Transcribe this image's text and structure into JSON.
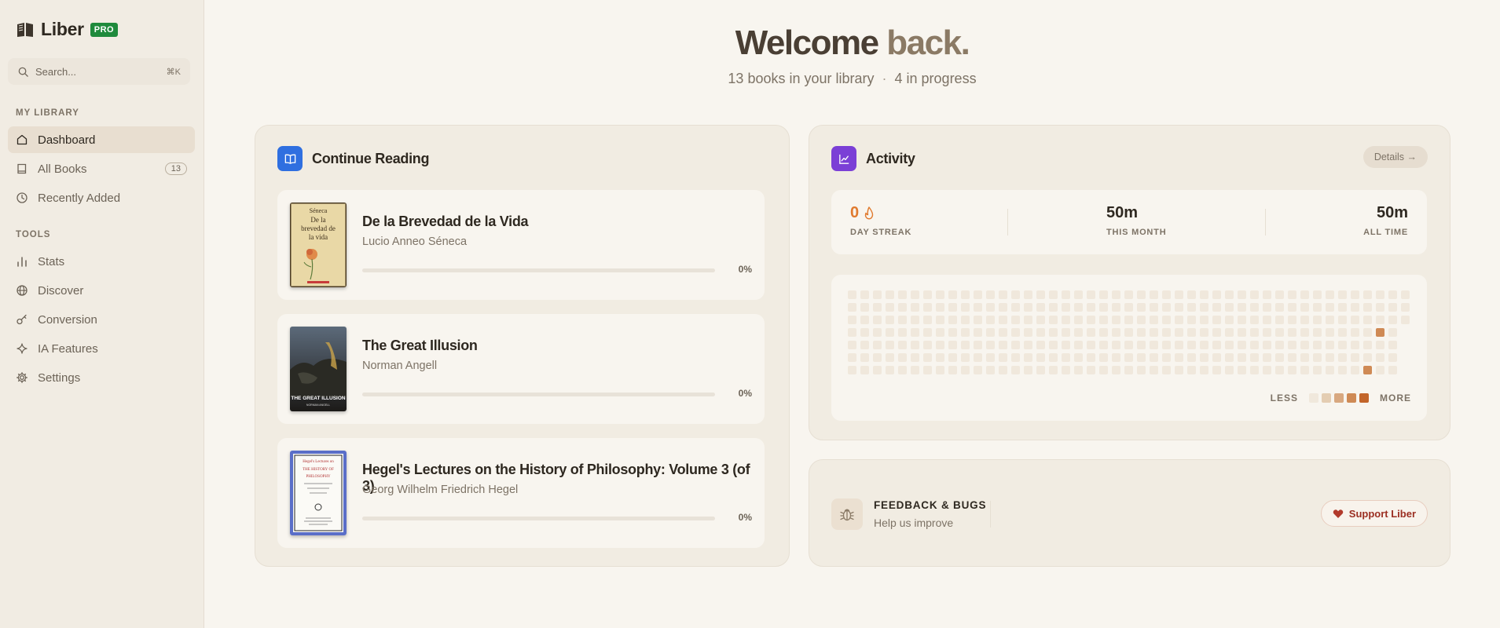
{
  "sidebar": {
    "brand": "Liber",
    "badge": "PRO",
    "search": {
      "placeholder": "Search...",
      "shortcut": "⌘K"
    },
    "sections": [
      {
        "label": "MY LIBRARY"
      },
      {
        "label": "TOOLS"
      }
    ],
    "items": [
      {
        "label": "Dashboard",
        "icon": "home-icon",
        "active": true
      },
      {
        "label": "All Books",
        "icon": "book-icon",
        "count": "13"
      },
      {
        "label": "Recently Added",
        "icon": "clock-icon"
      },
      {
        "label": "Stats",
        "icon": "bar-chart-icon"
      },
      {
        "label": "Discover",
        "icon": "globe-icon"
      },
      {
        "label": "Conversion",
        "icon": "key-icon"
      },
      {
        "label": "IA Features",
        "icon": "sparkle-icon"
      },
      {
        "label": "Settings",
        "icon": "gear-icon"
      }
    ]
  },
  "header": {
    "welcome_1": "Welcome",
    "welcome_2": "back.",
    "books_count": "13 books in your library",
    "separator": "·",
    "in_progress": "4 in progress"
  },
  "continue_reading": {
    "title": "Continue Reading",
    "books": [
      {
        "title": "De la Brevedad de la Vida",
        "author": "Lucio Anneo Séneca",
        "progress": 0,
        "progress_label": "0%",
        "cover_lines": [
          "Séneca",
          "De la",
          "brevedad de",
          "la vida"
        ]
      },
      {
        "title": "The Great Illusion",
        "author": "Norman Angell",
        "progress": 0,
        "progress_label": "0%",
        "cover_lines": [
          "THE GREAT ILLUSION",
          "NORMAN ANGELL"
        ]
      },
      {
        "title": "Hegel's Lectures on the History of Philosophy: Volume 3 (of 3)",
        "author": "Georg Wilhelm Friedrich Hegel",
        "progress": 0,
        "progress_label": "0%",
        "cover_lines": [
          "Hegel's Lectures on",
          "THE HISTORY OF",
          "PHILOSOPHY"
        ]
      }
    ]
  },
  "activity": {
    "title": "Activity",
    "details_label": "Details →",
    "stats": [
      {
        "value": "0",
        "label": "DAY STREAK",
        "accent": "#e07a2e"
      },
      {
        "value": "50m",
        "label": "THIS MONTH"
      },
      {
        "value": "50m",
        "label": "ALL TIME"
      }
    ],
    "heatmap": {
      "weeks": 45,
      "days": 7,
      "active_cells": [
        {
          "week": 42,
          "day": 3,
          "level": 3
        },
        {
          "week": 41,
          "day": 6,
          "level": 3
        }
      ],
      "legend_less": "LESS",
      "legend_more": "MORE",
      "legend_colors": [
        "#f0e8dc",
        "#e4cdb2",
        "#d8a880",
        "#cf8a55",
        "#c2652a"
      ]
    }
  },
  "feedback": {
    "title": "FEEDBACK & BUGS",
    "subtitle": "Help us improve",
    "support_label": "Support Liber"
  }
}
